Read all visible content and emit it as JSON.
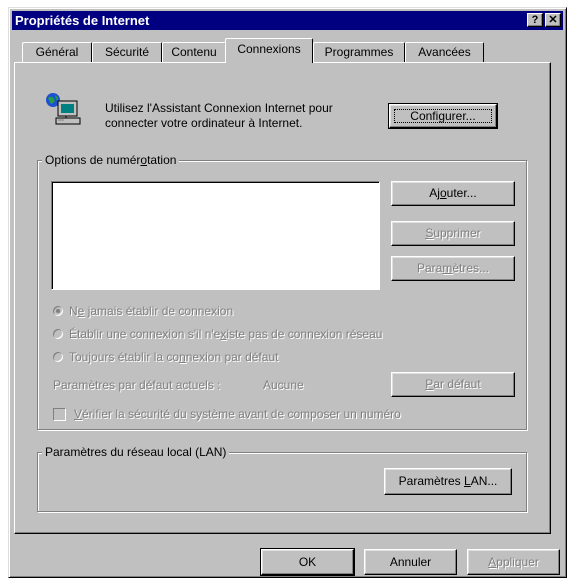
{
  "window": {
    "title": "Propriétés de Internet",
    "help_glyph": "?",
    "close_glyph": "✕"
  },
  "tabs": [
    {
      "label": "Général"
    },
    {
      "label": "Sécurité"
    },
    {
      "label": "Contenu"
    },
    {
      "label": "Connexions",
      "active": true
    },
    {
      "label": "Programmes"
    },
    {
      "label": "Avancées"
    }
  ],
  "wizard": {
    "text_line1": "Utilisez l'Assistant Connexion Internet pour",
    "text_line2": "connecter votre ordinateur à Internet.",
    "icon": "network-computer-icon",
    "configure_label_pre": "Confi",
    "configure_label_key": "g",
    "configure_label_post": "urer..."
  },
  "dialup": {
    "group_label_pre": "Options de numér",
    "group_label_key": "o",
    "group_label_post": "tation",
    "connections": [],
    "add_pre": "Aj",
    "add_key": "o",
    "add_post": "uter...",
    "remove_key": "S",
    "remove_post": "upprimer",
    "settings_pre": "Para",
    "settings_key": "m",
    "settings_post": "ètres...",
    "radio_never_pre": "N",
    "radio_never_key": "e",
    "radio_never_post": " jamais établir de connexion",
    "radio_when_pre": "Établir une connexion s'il n'e",
    "radio_when_key": "x",
    "radio_when_post": "iste pas de connexion réseau",
    "radio_always_pre": "Toujours établir la co",
    "radio_always_key": "n",
    "radio_always_post": "nexion par défaut",
    "selected_radio": "never",
    "current_default_label": "Paramètres par défaut actuels :",
    "current_default_value": "Aucune",
    "default_btn_key": "P",
    "default_btn_post": "ar défaut",
    "check_security_key": "V",
    "check_security_post": "érifier la sécurité du système avant de composer un numéro",
    "check_security_checked": false
  },
  "lan": {
    "group_label": "Paramètres du réseau local (LAN)",
    "settings_pre": "Paramètres ",
    "settings_key": "L",
    "settings_post": "AN..."
  },
  "footer": {
    "ok": "OK",
    "cancel": "Annuler",
    "apply_key": "A",
    "apply_post": "ppliquer"
  },
  "colors": {
    "face": "#c0c0c0",
    "titlebar": "#000080",
    "disabled_text": "#808080"
  }
}
